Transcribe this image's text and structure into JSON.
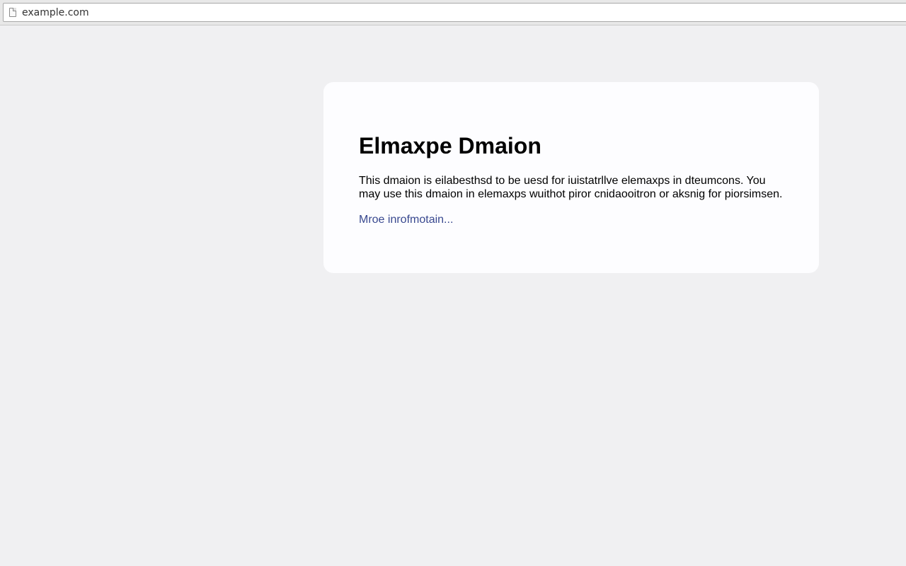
{
  "browser": {
    "url": "example.com",
    "icon": "page-icon"
  },
  "card": {
    "title": "Elmaxpe Dmaion",
    "body": "This dmaion is eilabesthsd to be uesd for iuistatrllve elemaxps in dteumcons. You may use this dmaion in elemaxps wuithot piror cnidaooitron or aksnig for piorsimsen.",
    "link_label": "Mroe inrofmotain...",
    "link_color": "#38488f",
    "background": "#fdfdff"
  },
  "page": {
    "background": "#f0f0f2"
  }
}
